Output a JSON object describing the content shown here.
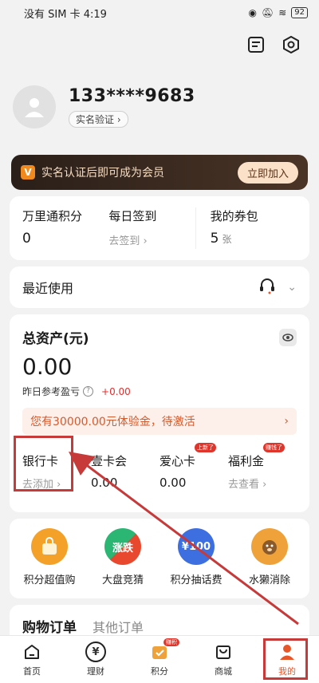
{
  "status": {
    "carrier": "没有 SIM 卡 4:19",
    "battery": "92"
  },
  "profile": {
    "phone": "133****9683",
    "verify": "实名验证"
  },
  "vip": {
    "badge": "V",
    "text": "实名认证后即可成为会员",
    "button": "立即加入"
  },
  "stats": [
    {
      "label": "万里通积分",
      "value": "0",
      "sub": ""
    },
    {
      "label": "每日签到",
      "value": "",
      "sub": "去签到"
    },
    {
      "label": "我的券包",
      "value": "5",
      "unit": "张",
      "sub": ""
    }
  ],
  "recent": {
    "title": "最近使用"
  },
  "assets": {
    "title": "总资产(元)",
    "value": "0.00",
    "yesterday_label": "昨日参考盈亏",
    "yesterday_value": "+0.00",
    "trial_text": "您有30000.00元体验金，待激活",
    "accounts": [
      {
        "label": "银行卡",
        "sub": "去添加",
        "value": ""
      },
      {
        "label": "壹卡会",
        "sub": "",
        "value": "0.00"
      },
      {
        "label": "爱心卡",
        "sub": "",
        "value": "0.00",
        "tag": "上新了"
      },
      {
        "label": "福利金",
        "sub": "去查看",
        "value": "",
        "tag": "赚钱了"
      }
    ]
  },
  "features": [
    {
      "label": "积分超值购",
      "color": "#f4a12a",
      "icon": "gift-bag-icon"
    },
    {
      "label": "大盘竞猜",
      "color": "#2bb673",
      "icon": "stock-guess-icon",
      "glyph": "涨跌"
    },
    {
      "label": "积分抽话费",
      "color": "#3d6fe0",
      "icon": "phone-fee-icon",
      "glyph": "¥100"
    },
    {
      "label": "水獭消除",
      "color": "#f0a23a",
      "icon": "otter-game-icon"
    }
  ],
  "orders": {
    "active_tab": "购物订单",
    "other_tab": "其他订单"
  },
  "tabbar": [
    {
      "label": "首页",
      "icon": "home-icon"
    },
    {
      "label": "理财",
      "icon": "finance-icon",
      "glyph": "¥"
    },
    {
      "label": "积分",
      "icon": "points-icon",
      "badge": "赚积"
    },
    {
      "label": "商城",
      "icon": "mall-icon"
    },
    {
      "label": "我的",
      "icon": "profile-icon"
    }
  ],
  "colors": {
    "accent": "#e8572a",
    "annotation": "#c63a3a"
  }
}
